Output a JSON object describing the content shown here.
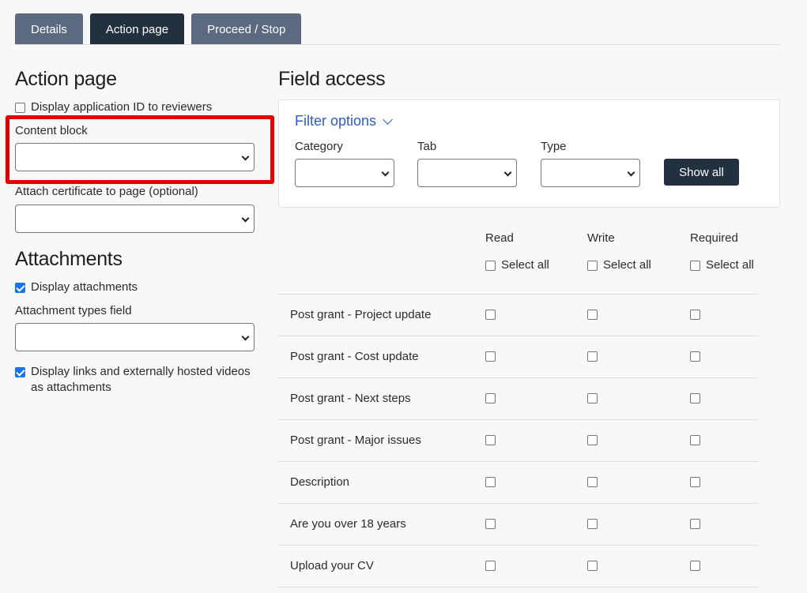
{
  "tabs": [
    {
      "label": "Details",
      "active": false
    },
    {
      "label": "Action page",
      "active": true
    },
    {
      "label": "Proceed / Stop",
      "active": false
    }
  ],
  "action_page": {
    "heading": "Action page",
    "display_app_id_label": "Display application ID to reviewers",
    "display_app_id_checked": false,
    "content_block_label": "Content block",
    "content_block_value": "",
    "certificate_label": "Attach certificate to page (optional)",
    "certificate_value": ""
  },
  "attachments": {
    "heading": "Attachments",
    "display_attachments_label": "Display attachments",
    "display_attachments_checked": true,
    "types_field_label": "Attachment types field",
    "types_field_value": "",
    "display_links_label_line1": "Display links and externally hosted videos",
    "display_links_label_line2": "as attachments",
    "display_links_checked": true
  },
  "field_access": {
    "heading": "Field access",
    "filter": {
      "title": "Filter options",
      "category_label": "Category",
      "tab_label": "Tab",
      "type_label": "Type",
      "show_all_label": "Show all"
    },
    "columns": {
      "read": "Read",
      "write": "Write",
      "required": "Required",
      "select_all": "Select all"
    },
    "rows": [
      {
        "label": "Post grant - Project update"
      },
      {
        "label": "Post grant - Cost update"
      },
      {
        "label": "Post grant - Next steps"
      },
      {
        "label": "Post grant - Major issues"
      },
      {
        "label": "Description"
      },
      {
        "label": "Are you over 18 years"
      },
      {
        "label": "Upload your CV"
      }
    ]
  },
  "colors": {
    "tab_active": "#223040",
    "tab_inactive": "#5b6a80",
    "highlight": "#e00000",
    "link": "#2f5dc4"
  }
}
